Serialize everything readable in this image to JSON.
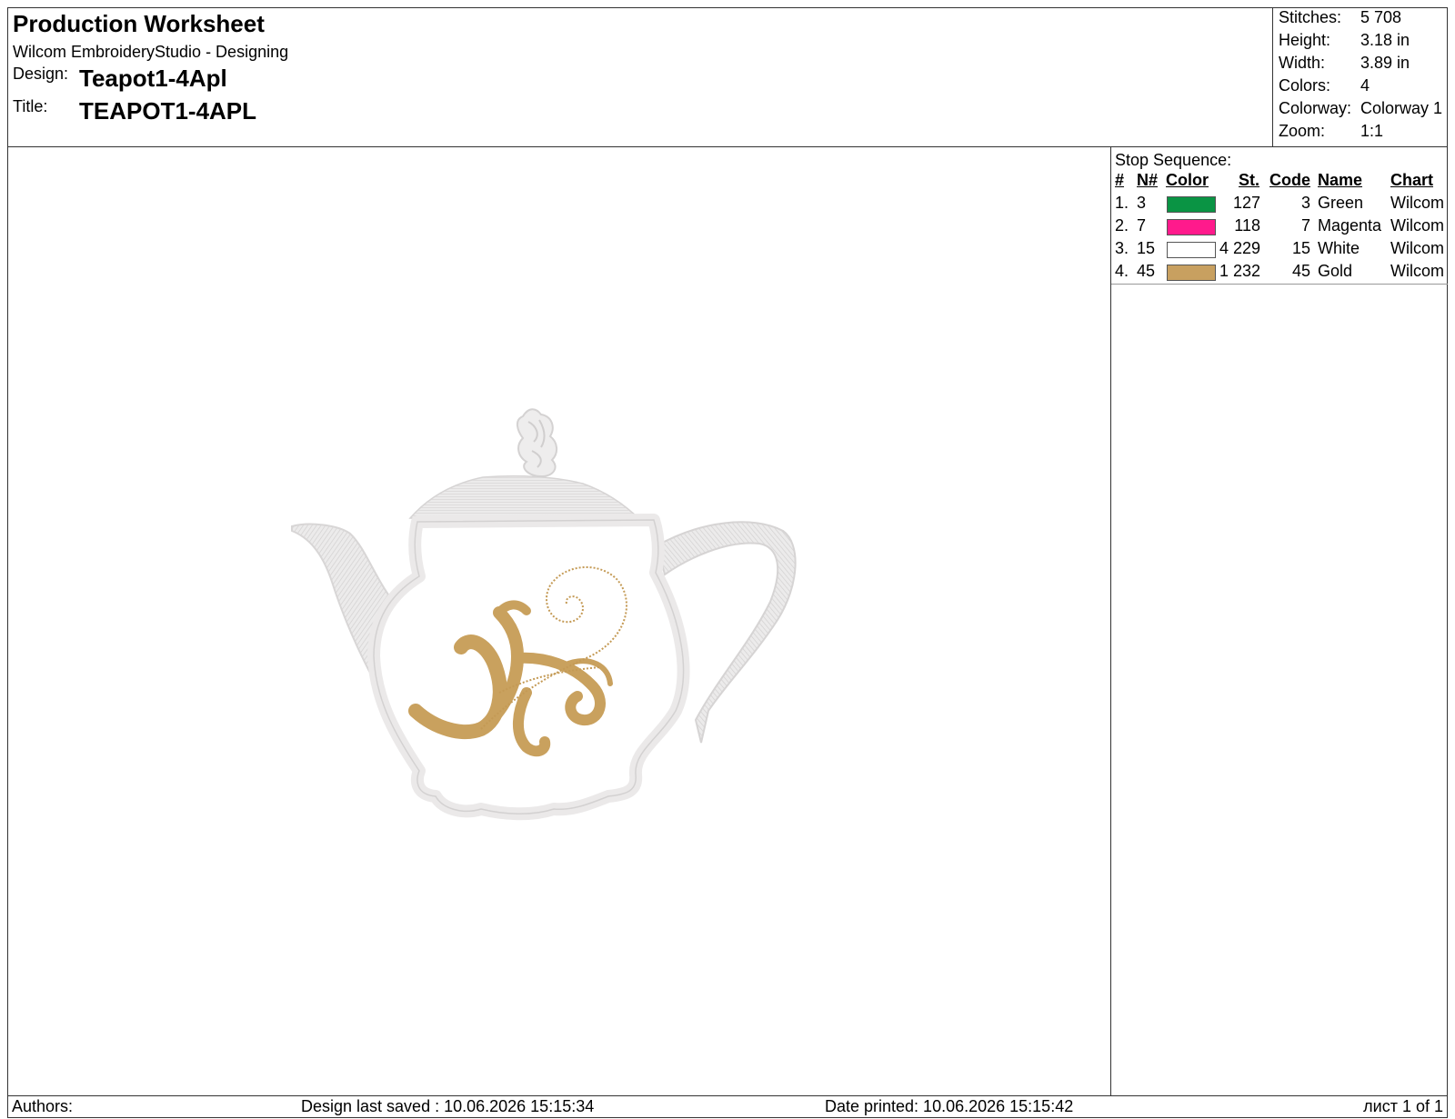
{
  "header": {
    "title": "Production Worksheet",
    "subtitle": "Wilcom EmbroideryStudio - Designing",
    "design_label": "Design:",
    "design_value": "Teapot1-4Apl",
    "title_label": "Title:",
    "title_value": "TEAPOT1-4APL"
  },
  "stats": {
    "stitches_label": "Stitches:",
    "stitches": "5 708",
    "height_label": "Height:",
    "height": "3.18 in",
    "width_label": "Width:",
    "width": "3.89 in",
    "colors_label": "Colors:",
    "colors": "4",
    "colorway_label": "Colorway:",
    "colorway": "Colorway 1",
    "zoom_label": "Zoom:",
    "zoom": "1:1"
  },
  "sequence": {
    "title": "Stop Sequence:",
    "headers": {
      "num": "#",
      "n": "N#",
      "color": "Color",
      "st": "St.",
      "code": "Code",
      "name": "Name",
      "chart": "Chart"
    },
    "rows": [
      {
        "num": "1.",
        "n": "3",
        "color": "#0a9444",
        "st": "127",
        "code": "3",
        "name": "Green",
        "chart": "Wilcom"
      },
      {
        "num": "2.",
        "n": "7",
        "color": "#ff1a8c",
        "st": "118",
        "code": "7",
        "name": "Magenta",
        "chart": "Wilcom"
      },
      {
        "num": "3.",
        "n": "15",
        "color": "#ffffff",
        "st": "4 229",
        "code": "15",
        "name": "White",
        "chart": "Wilcom"
      },
      {
        "num": "4.",
        "n": "45",
        "color": "#c8a060",
        "st": "1 232",
        "code": "45",
        "name": "Gold",
        "chart": "Wilcom"
      }
    ]
  },
  "footer": {
    "authors": "Authors:",
    "saved": "Design last saved : 10.06.2026 15:15:34",
    "printed": "Date printed: 10.06.2026 15:15:42",
    "page": "лист 1 of 1"
  }
}
